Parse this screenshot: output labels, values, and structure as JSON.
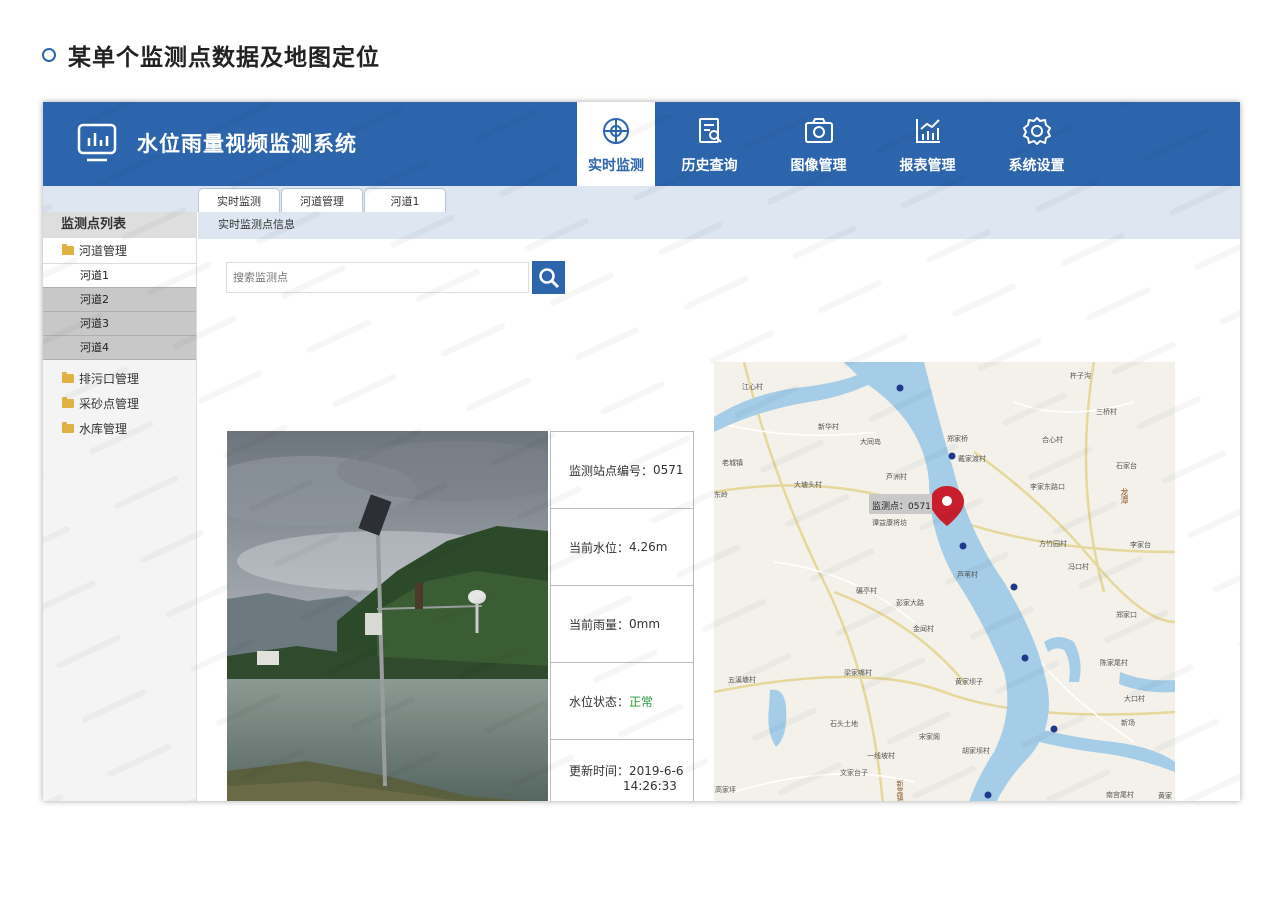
{
  "page": {
    "heading": "某单个监测点数据及地图定位"
  },
  "app": {
    "title": "水位雨量视频监测系统",
    "accent": "#2d65ad"
  },
  "nav": [
    {
      "label": "实时监测",
      "icon": "compass-icon",
      "active": true
    },
    {
      "label": "历史查询",
      "icon": "history-doc-icon",
      "active": false
    },
    {
      "label": "图像管理",
      "icon": "camera-icon",
      "active": false
    },
    {
      "label": "报表管理",
      "icon": "chart-icon",
      "active": false
    },
    {
      "label": "系统设置",
      "icon": "gear-icon",
      "active": false
    }
  ],
  "tabs": [
    "实时监测",
    "河道管理",
    "河道1"
  ],
  "breadcrumb": "实时监测点信息",
  "sidebar": {
    "title": "监测点列表",
    "groups": [
      {
        "label": "河道管理",
        "items": [
          "河道1",
          "河道2",
          "河道3",
          "河道4"
        ],
        "active_item": "河道1"
      },
      {
        "label": "排污口管理"
      },
      {
        "label": "采砂点管理"
      },
      {
        "label": "水库管理"
      }
    ]
  },
  "search": {
    "placeholder": "搜索监测点"
  },
  "station": {
    "code_label": "监测站点编号：",
    "code": "0571",
    "level_label": "当前水位：",
    "level": "4.26m",
    "rain_label": "当前雨量：",
    "rain": "0mm",
    "status_label": "水位状态：",
    "status": "正常",
    "status_color": "#2b9a3c",
    "time_label": "更新时间：",
    "time_date": "2019-6-6",
    "time_clock": "14:26:33"
  },
  "map": {
    "marker_label": "监测点：0571",
    "places": [
      "江心村",
      "新华村",
      "大同岛",
      "老城镇",
      "大塘头村",
      "芦洲村",
      "郑家桥",
      "戴家渡村",
      "合心村",
      "三桥村",
      "石家台",
      "李家东路口",
      "东岭",
      "谭益康将坊",
      "方竹园村",
      "李家台",
      "芦苇村",
      "冯口村",
      "碾亭村",
      "新旧大路",
      "彭家大路",
      "金闻村",
      "郑家口",
      "五溪塘村",
      "梁家嘴村",
      "黄家坝子",
      "陈家尾村",
      "大口村",
      "石头土地",
      "宋家阁",
      "新场",
      "一线坡村",
      "胡家坝村",
      "文家台子",
      "高家坪",
      "南宫尾村",
      "黄家",
      "龙潭",
      "新堂镇",
      "杵子沟"
    ]
  }
}
